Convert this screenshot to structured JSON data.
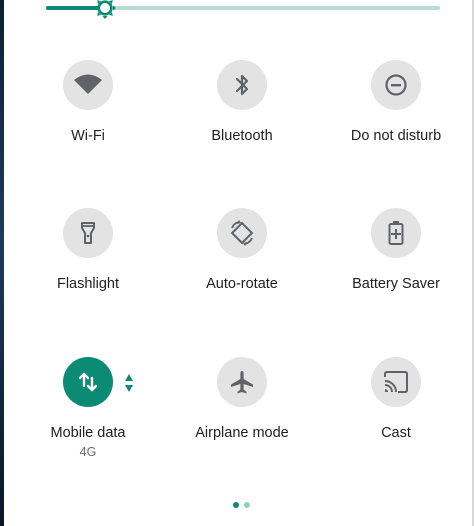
{
  "brightness": {
    "level_fraction": 0.15
  },
  "tiles": [
    {
      "label": "Wi-Fi",
      "icon": "wifi-icon",
      "active": false
    },
    {
      "label": "Bluetooth",
      "icon": "bluetooth-icon",
      "active": false
    },
    {
      "label": "Do not disturb",
      "icon": "do-not-disturb-icon",
      "active": false
    },
    {
      "label": "Flashlight",
      "icon": "flashlight-icon",
      "active": false
    },
    {
      "label": "Auto-rotate",
      "icon": "auto-rotate-icon",
      "active": false
    },
    {
      "label": "Battery Saver",
      "icon": "battery-saver-icon",
      "active": false
    },
    {
      "label": "Mobile data",
      "sublabel": "4G",
      "icon": "mobile-data-icon",
      "active": true
    },
    {
      "label": "Airplane mode",
      "icon": "airplane-icon",
      "active": false
    },
    {
      "label": "Cast",
      "icon": "cast-icon",
      "active": false
    }
  ],
  "pager": {
    "pages": 2,
    "current": 1
  },
  "colors": {
    "accent": "#0b8a74",
    "tile_bg": "#e3e3e3",
    "icon_fg": "#5f6368",
    "track_bg": "#b5dcd5"
  }
}
